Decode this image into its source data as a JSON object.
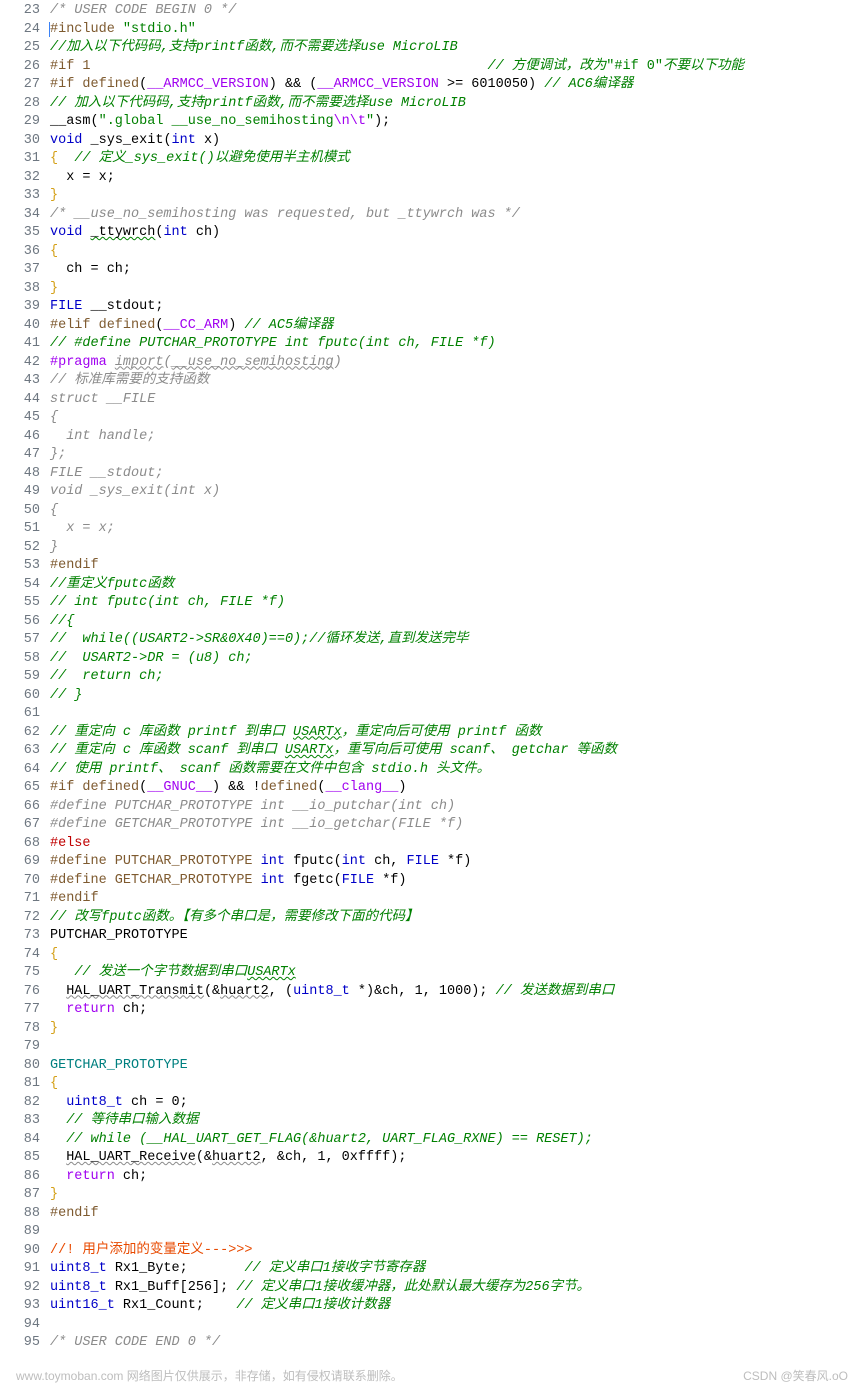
{
  "gutter": {
    "start": 23,
    "end": 95
  },
  "lines": {
    "23": [
      [
        "gray-i",
        "/* USER CODE BEGIN 0 */"
      ]
    ],
    "24": [
      [
        "cursor",
        ""
      ],
      [
        "brown",
        "#include "
      ],
      [
        "green",
        "\"stdio.h\""
      ]
    ],
    "25": [
      [
        "green-i",
        "//加入以下代码码,支持printf函数,而不需要选择use MicroLIB"
      ]
    ],
    "26": [
      [
        "brown",
        "#if 1"
      ],
      [
        "",
        "                                                 "
      ],
      [
        "green-i",
        "// 方便调试，改为"
      ],
      [
        "green",
        "\"#if 0\""
      ],
      [
        "green-i",
        "不要以下功能"
      ]
    ],
    "27": [
      [
        "brown",
        "#if defined"
      ],
      [
        "",
        "("
      ],
      [
        "purple",
        "__ARMCC_VERSION"
      ],
      [
        "",
        ") && ("
      ],
      [
        "purple",
        "__ARMCC_VERSION"
      ],
      [
        "",
        " >= 6010050) "
      ],
      [
        "green-i",
        "// AC6编译器"
      ]
    ],
    "28": [
      [
        "green-i",
        "// 加入以下代码码,支持printf函数,而不需要选择use MicroLIB"
      ]
    ],
    "29": [
      [
        "",
        "__asm("
      ],
      [
        "green",
        "\".global __use_no_semihosting"
      ],
      [
        "purple",
        "\\n\\t"
      ],
      [
        "green",
        "\""
      ],
      [
        "",
        ");"
      ]
    ],
    "30": [
      [
        "blue",
        "void"
      ],
      [
        "",
        " "
      ],
      [
        "fn",
        "_sys_exit"
      ],
      [
        "",
        "("
      ],
      [
        "blue",
        "int"
      ],
      [
        "",
        " x)"
      ]
    ],
    "31": [
      [
        "gold",
        "{"
      ],
      [
        "",
        "  "
      ],
      [
        "green-i",
        "// 定义_sys_exit()以避免使用半主机模式"
      ]
    ],
    "32": [
      [
        "",
        "  x = x;"
      ]
    ],
    "33": [
      [
        "gold",
        "}"
      ]
    ],
    "34": [
      [
        "gray-i",
        "/* __use_no_semihosting was requested, but _ttywrch was */"
      ]
    ],
    "35": [
      [
        "blue",
        "void"
      ],
      [
        "",
        " "
      ],
      [
        "fn wavy-g",
        "_ttywrch"
      ],
      [
        "",
        "("
      ],
      [
        "blue",
        "int"
      ],
      [
        "",
        " ch)"
      ]
    ],
    "36": [
      [
        "gold",
        "{"
      ]
    ],
    "37": [
      [
        "",
        "  ch = ch;"
      ]
    ],
    "38": [
      [
        "gold",
        "}"
      ]
    ],
    "39": [
      [
        "blue",
        "FILE"
      ],
      [
        "",
        " __stdout;"
      ]
    ],
    "40": [
      [
        "brown",
        "#elif defined"
      ],
      [
        "",
        "("
      ],
      [
        "purple",
        "__CC_ARM"
      ],
      [
        "",
        ") "
      ],
      [
        "green-i",
        "// AC5编译器"
      ]
    ],
    "41": [
      [
        "green-i",
        "// #define PUTCHAR_PROTOTYPE int fputc(int ch, FILE *f)"
      ]
    ],
    "42": [
      [
        "purple",
        "#pragma"
      ],
      [
        "",
        " "
      ],
      [
        "gray-i wavy-gr",
        "import"
      ],
      [
        "gray-i",
        "("
      ],
      [
        "gray-i wavy-gr",
        "__use_no_semihosting"
      ],
      [
        "gray-i",
        ")"
      ]
    ],
    "43": [
      [
        "gray-i",
        "// 标准库需要的支持函数"
      ]
    ],
    "44": [
      [
        "gray-i",
        "struct __FILE"
      ]
    ],
    "45": [
      [
        "gray-i",
        "{"
      ]
    ],
    "46": [
      [
        "gray-i",
        "  int handle;"
      ]
    ],
    "47": [
      [
        "gray-i",
        "};"
      ]
    ],
    "48": [
      [
        "gray-i",
        "FILE __stdout;"
      ]
    ],
    "49": [
      [
        "gray-i",
        "void _sys_exit(int x)"
      ]
    ],
    "50": [
      [
        "gray-i",
        "{"
      ]
    ],
    "51": [
      [
        "gray-i",
        "  x = x;"
      ]
    ],
    "52": [
      [
        "gray-i",
        "}"
      ]
    ],
    "53": [
      [
        "brown",
        "#endif"
      ]
    ],
    "54": [
      [
        "green-i",
        "//重定义fputc函数"
      ]
    ],
    "55": [
      [
        "green-i",
        "// int fputc(int ch, FILE *f)"
      ]
    ],
    "56": [
      [
        "green-i",
        "//{"
      ]
    ],
    "57": [
      [
        "green-i",
        "//  while((USART2->SR&0X40)==0);//循环发送,直到发送完毕"
      ]
    ],
    "58": [
      [
        "green-i",
        "//  USART2->DR = (u8) ch;"
      ]
    ],
    "59": [
      [
        "green-i",
        "//  return ch;"
      ]
    ],
    "60": [
      [
        "green-i",
        "// }"
      ]
    ],
    "61": [
      [
        "",
        ""
      ]
    ],
    "62": [
      [
        "green-i",
        "// 重定向 c 库函数 printf 到串口 "
      ],
      [
        "green-i wavy-g",
        "USARTx"
      ],
      [
        "green-i",
        "，重定向后可使用 printf 函数"
      ]
    ],
    "63": [
      [
        "green-i",
        "// 重定向 c 库函数 scanf 到串口 "
      ],
      [
        "green-i wavy-g",
        "USARTx"
      ],
      [
        "green-i",
        "，重写向后可使用 scanf、 getchar 等函数"
      ]
    ],
    "64": [
      [
        "green-i",
        "// 使用 printf、 scanf 函数需要在文件中包含 stdio.h 头文件。"
      ]
    ],
    "65": [
      [
        "brown",
        "#if defined"
      ],
      [
        "",
        "("
      ],
      [
        "purple",
        "__GNUC__"
      ],
      [
        "",
        ") && !"
      ],
      [
        "brown",
        "defined"
      ],
      [
        "",
        "("
      ],
      [
        "purple",
        "__clang__"
      ],
      [
        "",
        ")"
      ]
    ],
    "66": [
      [
        "gray-i",
        "#define PUTCHAR_PROTOTYPE int __io_putchar(int ch)"
      ]
    ],
    "67": [
      [
        "gray-i",
        "#define GETCHAR_PROTOTYPE int __io_getchar(FILE *f)"
      ]
    ],
    "68": [
      [
        "red",
        "#else"
      ]
    ],
    "69": [
      [
        "brown",
        "#define PUTCHAR_PROTOTYPE "
      ],
      [
        "blue",
        "int"
      ],
      [
        "",
        " "
      ],
      [
        "fn",
        "fputc"
      ],
      [
        "",
        "("
      ],
      [
        "blue",
        "int"
      ],
      [
        "",
        " ch, "
      ],
      [
        "blue",
        "FILE"
      ],
      [
        "",
        " *f)"
      ]
    ],
    "70": [
      [
        "brown",
        "#define GETCHAR_PROTOTYPE "
      ],
      [
        "blue",
        "int"
      ],
      [
        "",
        " "
      ],
      [
        "fn",
        "fgetc"
      ],
      [
        "",
        "("
      ],
      [
        "blue",
        "FILE"
      ],
      [
        "",
        " *f)"
      ]
    ],
    "71": [
      [
        "brown",
        "#endif"
      ]
    ],
    "72": [
      [
        "green-i",
        "// 改写fputc函数。【有多个串口是，需要修改下面的代码】"
      ]
    ],
    "73": [
      [
        "",
        "PUTCHAR_PROTOTYPE"
      ]
    ],
    "74": [
      [
        "gold",
        "{"
      ]
    ],
    "75": [
      [
        "",
        "   "
      ],
      [
        "green-i",
        "// 发送一个字节数据到串口"
      ],
      [
        "green-i wavy-g",
        "USARTx"
      ]
    ],
    "76": [
      [
        "",
        "  "
      ],
      [
        "fn wavy-gr",
        "HAL_UART_Transmit"
      ],
      [
        "",
        "(&"
      ],
      [
        "wavy-gr",
        "huart2"
      ],
      [
        "",
        ", ("
      ],
      [
        "blue",
        "uint8_t"
      ],
      [
        "",
        " *)&ch, 1, 1000); "
      ],
      [
        "green-i",
        "// 发送数据到串口"
      ]
    ],
    "77": [
      [
        "",
        "  "
      ],
      [
        "purple",
        "return"
      ],
      [
        "",
        " ch;"
      ]
    ],
    "78": [
      [
        "gold",
        "}"
      ]
    ],
    "79": [
      [
        "",
        ""
      ]
    ],
    "80": [
      [
        "teal",
        "GETCHAR_PROTOTYPE"
      ]
    ],
    "81": [
      [
        "gold",
        "{"
      ]
    ],
    "82": [
      [
        "",
        "  "
      ],
      [
        "blue",
        "uint8_t"
      ],
      [
        "",
        " ch = 0;"
      ]
    ],
    "83": [
      [
        "",
        "  "
      ],
      [
        "green-i",
        "// 等待串口输入数据"
      ]
    ],
    "84": [
      [
        "",
        "  "
      ],
      [
        "green-i",
        "// while (__HAL_UART_GET_FLAG(&huart2, UART_FLAG_RXNE) == RESET);"
      ]
    ],
    "85": [
      [
        "",
        "  "
      ],
      [
        "fn wavy-gr",
        "HAL_UART_Receive"
      ],
      [
        "",
        "(&"
      ],
      [
        "wavy-gr",
        "huart2"
      ],
      [
        "",
        ", &ch, 1, 0xffff);"
      ]
    ],
    "86": [
      [
        "",
        "  "
      ],
      [
        "purple",
        "return"
      ],
      [
        "",
        " ch;"
      ]
    ],
    "87": [
      [
        "gold",
        "}"
      ]
    ],
    "88": [
      [
        "brown",
        "#endif"
      ]
    ],
    "89": [
      [
        "",
        ""
      ]
    ],
    "90": [
      [
        "redbr",
        "//! 用户添加的变量定义--->>>"
      ]
    ],
    "91": [
      [
        "blue",
        "uint8_t"
      ],
      [
        "",
        " Rx1_Byte;       "
      ],
      [
        "green-i",
        "// 定义串口1接收字节寄存器"
      ]
    ],
    "92": [
      [
        "blue",
        "uint8_t"
      ],
      [
        "",
        " Rx1_Buff[256]; "
      ],
      [
        "green-i",
        "// 定义串口1接收缓冲器，此处默认最大缓存为256字节。"
      ]
    ],
    "93": [
      [
        "blue",
        "uint16_t"
      ],
      [
        "",
        " Rx1_Count;    "
      ],
      [
        "green-i",
        "// 定义串口1接收计数器"
      ]
    ],
    "94": [
      [
        "",
        ""
      ]
    ],
    "95": [
      [
        "gray-i",
        "/* USER CODE END 0 */"
      ]
    ]
  },
  "footer_left": "www.toymoban.com  网络图片仅供展示，非存储，如有侵权请联系删除。",
  "footer_right": "CSDN @笑春风.oO"
}
